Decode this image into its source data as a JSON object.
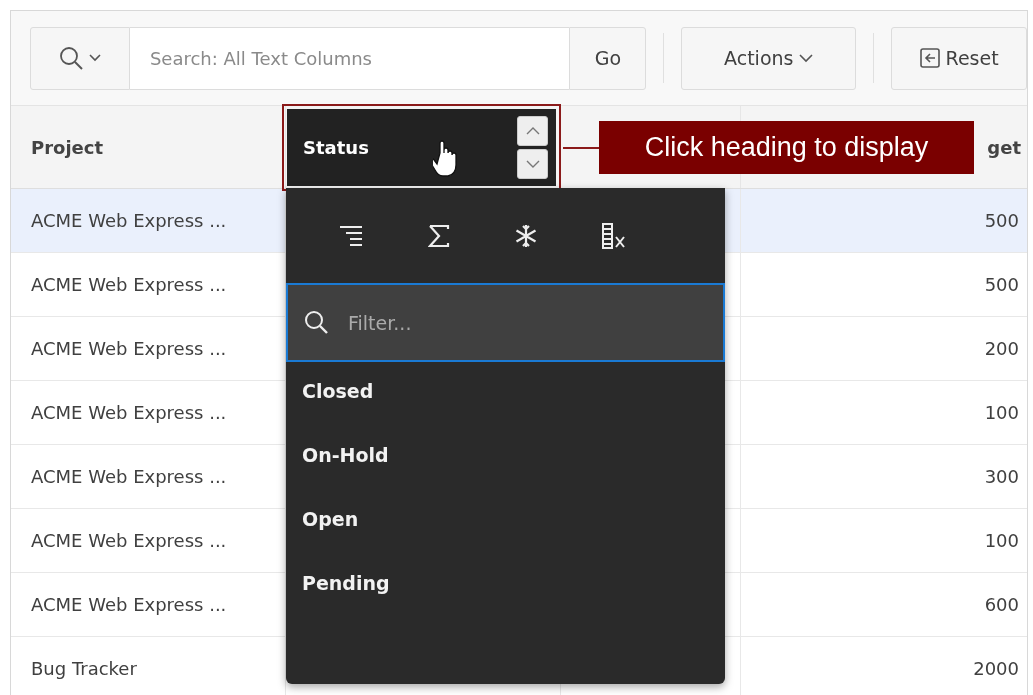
{
  "toolbar": {
    "search_field": {
      "placeholder": "Search: All Text Columns"
    },
    "go_button": "Go",
    "actions_button": "Actions",
    "reset_button": "Reset"
  },
  "table": {
    "headers": [
      {
        "kind": "plain",
        "label": "Project"
      },
      {
        "kind": "active",
        "label": "Status"
      },
      {
        "kind": "hidden"
      },
      {
        "kind": "plain",
        "label": "get"
      }
    ],
    "rows": [
      {
        "project": "ACME Web Express ...",
        "column_4": "500",
        "selected": true
      },
      {
        "project": "ACME Web Express ...",
        "column_4": "500",
        "selected": false
      },
      {
        "project": "ACME Web Express ...",
        "column_4": "200",
        "selected": false
      },
      {
        "project": "ACME Web Express ...",
        "column_4": "100",
        "selected": false
      },
      {
        "project": "ACME Web Express ...",
        "column_4": "300",
        "selected": false
      },
      {
        "project": "ACME Web Express ...",
        "column_4": "100",
        "selected": false
      },
      {
        "project": "ACME Web Express ...",
        "column_4": "600",
        "selected": false
      },
      {
        "project": "Bug Tracker",
        "column_4": "2000",
        "selected": false
      }
    ]
  },
  "column_menu": {
    "filter": {
      "placeholder": "Filter..."
    },
    "values": [
      "Closed",
      "On-Hold",
      "Open",
      "Pending"
    ]
  },
  "callout": {
    "text": "Click heading to display"
  }
}
